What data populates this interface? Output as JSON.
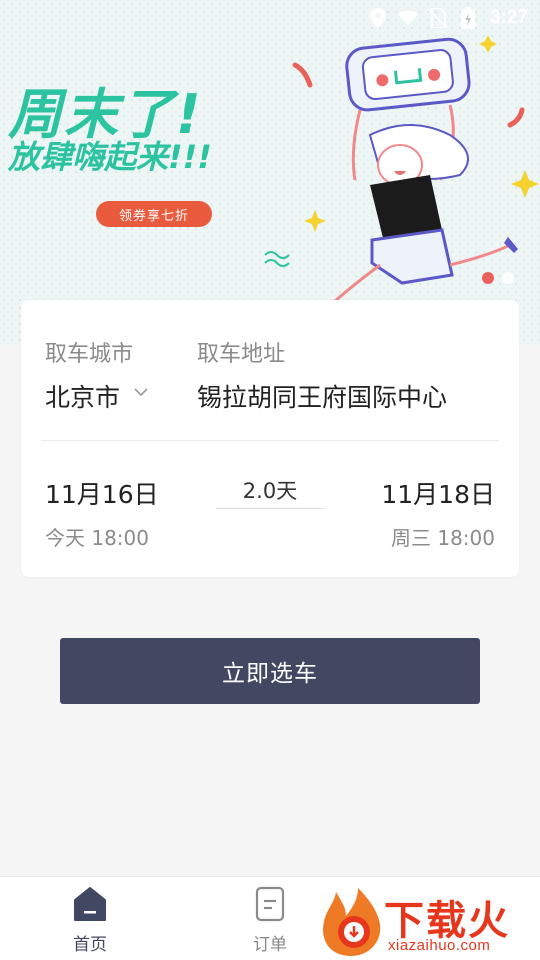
{
  "status_bar": {
    "time": "3:27"
  },
  "banner": {
    "headline": "周末了!",
    "subheadline": "放肆嗨起来!!!",
    "coupon": "领券享七折",
    "slide_count": 2,
    "active_slide": 1,
    "colors": {
      "headline": "#2cc3a0",
      "coupon": "#ea5b3d"
    }
  },
  "booking": {
    "city_label": "取车城市",
    "city_value": "北京市",
    "address_label": "取车地址",
    "address_value": "锡拉胡同王府国际中心",
    "pickup_date": "11月16日",
    "pickup_time": "今天 18:00",
    "duration": "2.0天",
    "return_date": "11月18日",
    "return_time": "周三 18:00"
  },
  "cta": {
    "label": "立即选车",
    "color": "#434862"
  },
  "tabbar": {
    "items": [
      {
        "label": "首页",
        "icon": "home-icon",
        "active": true
      },
      {
        "label": "订单",
        "icon": "order-icon",
        "active": false
      }
    ]
  },
  "watermark": {
    "text": "下载火",
    "sub": "xiazaihuo.com"
  }
}
